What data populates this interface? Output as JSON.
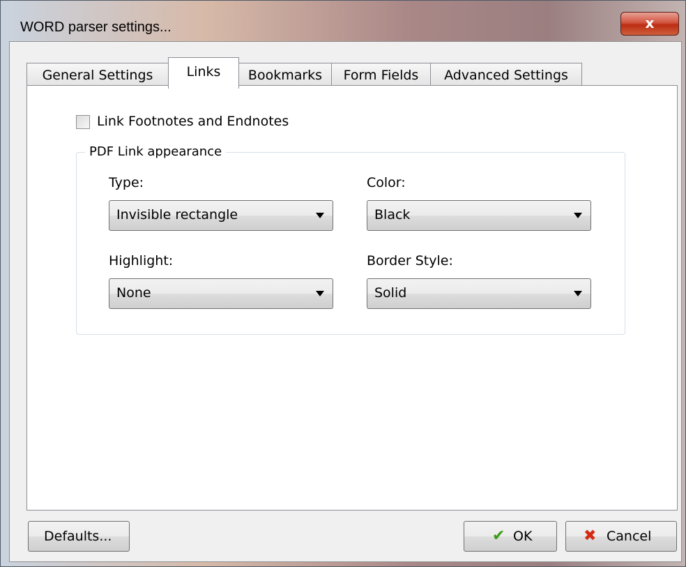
{
  "window": {
    "title": "WORD parser settings...",
    "close_label": "x"
  },
  "tabs": [
    {
      "label": "General Settings"
    },
    {
      "label": "Links"
    },
    {
      "label": "Bookmarks"
    },
    {
      "label": "Form Fields"
    },
    {
      "label": "Advanced Settings"
    }
  ],
  "active_tab": "Links",
  "links": {
    "footnotes_checkbox": {
      "label": "Link Footnotes and Endnotes",
      "checked": false
    },
    "group": {
      "legend": "PDF Link appearance",
      "type": {
        "label": "Type:",
        "value": "Invisible rectangle"
      },
      "color": {
        "label": "Color:",
        "value": "Black"
      },
      "highlight": {
        "label": "Highlight:",
        "value": "None"
      },
      "border_style": {
        "label": "Border Style:",
        "value": "Solid"
      }
    }
  },
  "buttons": {
    "defaults": "Defaults...",
    "ok": "OK",
    "cancel": "Cancel"
  },
  "icons": {
    "ok": "checkmark-icon",
    "cancel": "cross-icon"
  },
  "colors": {
    "ok_icon": "#3a9b15",
    "cancel_icon": "#d42a12",
    "close_button": "#c7452c"
  }
}
